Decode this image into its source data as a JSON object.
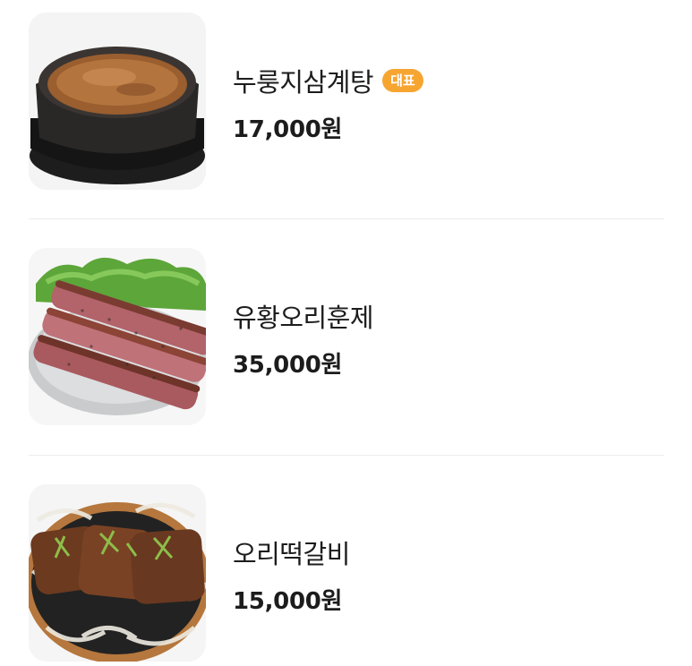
{
  "menu": {
    "items": [
      {
        "name": "누룽지삼계탕",
        "badge": "대표",
        "price": "17,000원",
        "image_icon": "stone-pot-soup-photo"
      },
      {
        "name": "유황오리훈제",
        "badge": "",
        "price": "35,000원",
        "image_icon": "smoked-duck-platter-photo"
      },
      {
        "name": "오리떡갈비",
        "badge": "",
        "price": "15,000원",
        "image_icon": "duck-patty-sizzling-plate-photo"
      }
    ]
  },
  "colors": {
    "badge": "#f7a531",
    "divider": "#ececec",
    "text": "#1c1c1c"
  }
}
